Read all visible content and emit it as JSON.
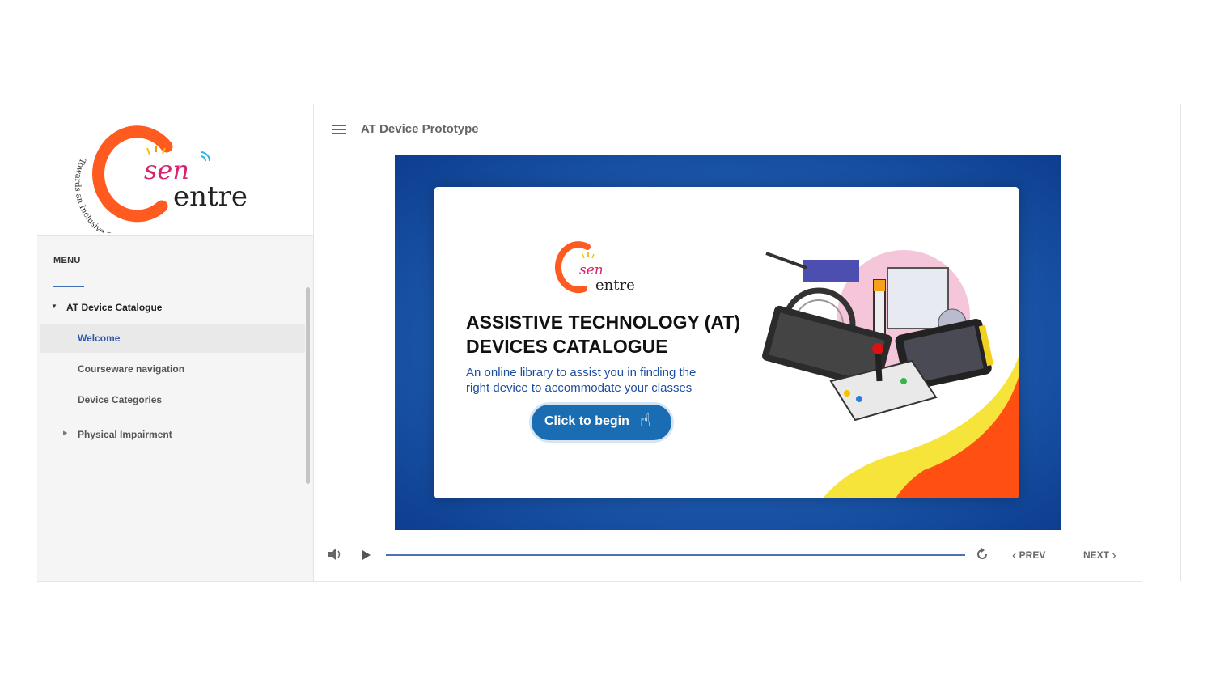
{
  "logo": {
    "wordmark_sen": "sen",
    "wordmark_entre": "entre",
    "tagline": "Towards an Inclusive Community"
  },
  "sidebar": {
    "menu_heading": "MENU",
    "group": {
      "label": "AT Device Catalogue",
      "icon": "caret-down-icon"
    },
    "items": [
      {
        "label": "Welcome",
        "selected": true
      },
      {
        "label": "Courseware navigation"
      },
      {
        "label": "Device Categories"
      },
      {
        "label": "Physical Impairment",
        "icon": "caret-right-icon"
      }
    ]
  },
  "header": {
    "title": "AT Device Prototype",
    "menu_icon": "hamburger-icon"
  },
  "slide": {
    "title_line1": "ASSISTIVE TECHNOLOGY (AT)",
    "title_line2": "DEVICES CATALOGUE",
    "subtitle_line1": "An online library to assist you in finding the",
    "subtitle_line2": "right device to accommodate your classes",
    "cta_label": "Click to begin",
    "cta_icon": "hand-pointer-icon",
    "colors": {
      "frame": "#1b56a9",
      "cta": "#1a6cb3",
      "accent_orange": "#ff4f12",
      "accent_yellow": "#f7e43a"
    }
  },
  "player": {
    "volume_icon": "volume-icon",
    "play_icon": "play-icon",
    "replay_icon": "replay-icon",
    "prev_label": "PREV",
    "next_label": "NEXT",
    "progress": 1.0
  }
}
